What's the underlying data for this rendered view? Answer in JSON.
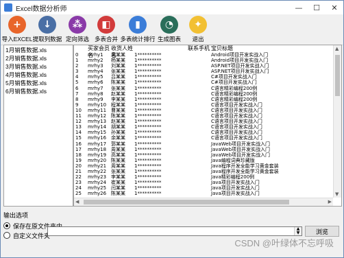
{
  "window": {
    "title": "Excel数据分析师",
    "minimize": "—",
    "maximize": "☐",
    "close": "✕"
  },
  "toolbar": [
    {
      "label": "导入EXCEL",
      "icon": "plus-icon",
      "color": "#e8652a",
      "glyph": "+"
    },
    {
      "label": "提取列数据",
      "icon": "download-icon",
      "color": "#4a6fa5",
      "glyph": "↓"
    },
    {
      "label": "定向筛选",
      "icon": "filter-icon",
      "color": "#8a3aa8",
      "glyph": "⁂"
    },
    {
      "label": "多表合并",
      "icon": "merge-icon",
      "color": "#d23b3b",
      "glyph": "◧"
    },
    {
      "label": "多表统计排行",
      "icon": "bar-chart-icon",
      "color": "#3b7dd8",
      "glyph": "▮"
    },
    {
      "label": "生成图表",
      "icon": "pie-chart-icon",
      "color": "#2a6e5a",
      "glyph": "◔"
    },
    {
      "label": "退出",
      "icon": "exit-icon",
      "color": "#f2c033",
      "glyph": "✦"
    }
  ],
  "files": [
    "1月销售数据.xls",
    "2月销售数据.xls",
    "3月销售数据.xls",
    "4月销售数据.xls",
    "5月销售数据.xls",
    "6月销售数据.xls"
  ],
  "grid": {
    "headers": [
      "",
      "买家会员名",
      "收货人姓名",
      "",
      "联系手机",
      "宝贝标题"
    ],
    "rows": [
      [
        "0",
        "mrhy1",
        "周某某",
        "1**********",
        "",
        "Android项目开发实战入门"
      ],
      [
        "1",
        "mrhy2",
        "杨某某",
        "1**********",
        "",
        "Android项目开发实战入门"
      ],
      [
        "2",
        "mrhy3",
        "刘某某",
        "1**********",
        "",
        "ASP.NET项目开发实战入门"
      ],
      [
        "3",
        "mrhy4",
        "张某某",
        "1**********",
        "",
        "ASP.NET项目开发实战入门"
      ],
      [
        "4",
        "mrhy5",
        "吕某某",
        "1**********",
        "",
        "C#项目开发实战入门"
      ],
      [
        "5",
        "mrhy6",
        "陈某某",
        "1**********",
        "",
        "C#项目开发实战入门"
      ],
      [
        "6",
        "mrhy7",
        "张某某",
        "1**********",
        "",
        "C语言精彩编程200例"
      ],
      [
        "7",
        "mrhy8",
        "赵某某",
        "1**********",
        "",
        "C语言精彩编程200例"
      ],
      [
        "8",
        "mrhy9",
        "李某某",
        "1**********",
        "",
        "C语言精彩编程200例"
      ],
      [
        "9",
        "mrhy10",
        "程某某",
        "1**********",
        "",
        "C语言项目开发实战入门"
      ],
      [
        "10",
        "mrhy11",
        "曹某某",
        "1**********",
        "",
        "C语言项目开发实战入门"
      ],
      [
        "11",
        "mrhy12",
        "陈某某",
        "1**********",
        "",
        "C语言项目开发实战入门"
      ],
      [
        "12",
        "mrhy13",
        "赵某某",
        "1**********",
        "",
        "C语言项目开发实战入门"
      ],
      [
        "13",
        "mrhy14",
        "胡某某",
        "1**********",
        "",
        "C语言项目开发实战入门"
      ],
      [
        "14",
        "mrhy15",
        "孙某某",
        "1**********",
        "",
        "C语言项目开发实战入门"
      ],
      [
        "15",
        "mrhy16",
        "余某某",
        "1**********",
        "",
        "C语言项目开发实战入门"
      ],
      [
        "16",
        "mrhy17",
        "郭某某",
        "1**********",
        "",
        "JavaWeb项目开发实战入门"
      ],
      [
        "17",
        "mrhy18",
        "周某某",
        "1**********",
        "",
        "JavaWeb项目开发实战入门"
      ],
      [
        "18",
        "mrhy19",
        "高某某",
        "1**********",
        "",
        "JavaWeb项目开发实战入门"
      ],
      [
        "19",
        "mrhy20",
        "陈某某",
        "1**********",
        "",
        "Java编程词典珍藏版"
      ],
      [
        "20",
        "mrhy21",
        "周某某",
        "1**********",
        "",
        "Java程序开发全能学习黄金套装"
      ],
      [
        "21",
        "mrhy22",
        "张某某",
        "1**********",
        "",
        "Java程序开发全能学习黄金套装"
      ],
      [
        "22",
        "mrhy23",
        "李某某",
        "1**********",
        "",
        "Java精彩编程200例"
      ],
      [
        "23",
        "mrhy24",
        "崔某某",
        "1**********",
        "",
        "Java项目开发实战入门"
      ],
      [
        "24",
        "mrhy25",
        "闫某某",
        "1**********",
        "",
        "Java项目开发实战入门"
      ],
      [
        "25",
        "mrhy26",
        "陈某某",
        "1**********",
        "",
        "Java项目开发实战入门"
      ]
    ]
  },
  "output": {
    "title": "输出选项",
    "option1": "保存在原文件夹内",
    "option2": "自定义文件夹",
    "browse": "浏览"
  },
  "watermark": "CSDN @叶绿体不忘呼吸"
}
